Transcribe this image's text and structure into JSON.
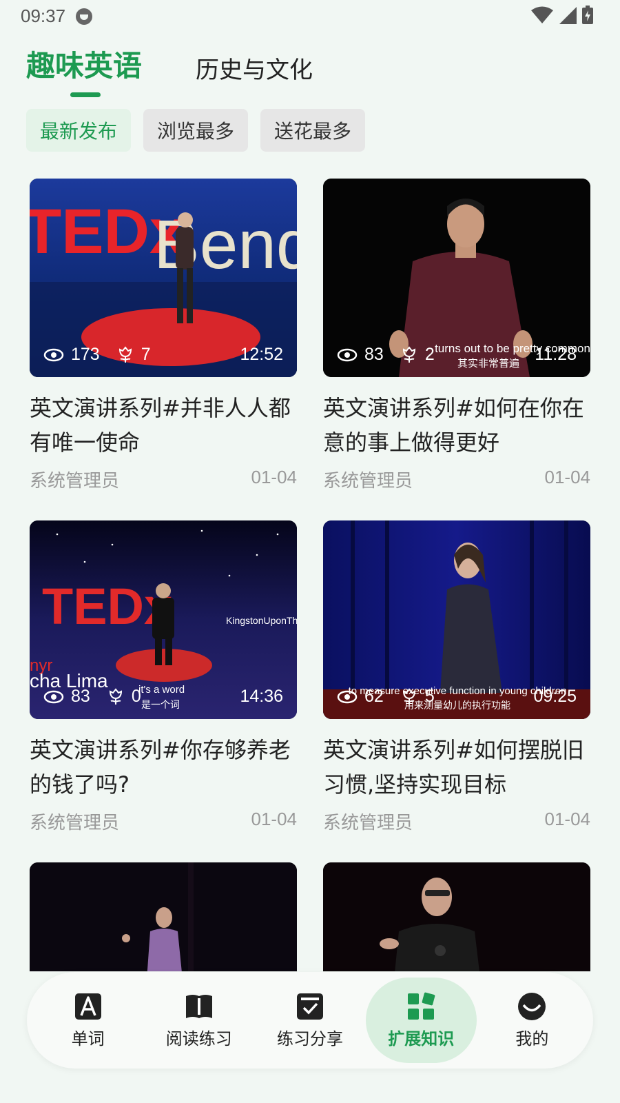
{
  "status_bar": {
    "time": "09:37"
  },
  "top_tabs": [
    {
      "label": "趣味英语",
      "active": true
    },
    {
      "label": "历史与文化",
      "active": false
    }
  ],
  "filters": [
    {
      "label": "最新发布",
      "active": true
    },
    {
      "label": "浏览最多",
      "active": false
    },
    {
      "label": "送花最多",
      "active": false
    }
  ],
  "videos": [
    {
      "title": "英文演讲系列#并非人人都有唯一使命",
      "author": "系统管理员",
      "date": "01-04",
      "views": "173",
      "flowers": "7",
      "duration": "12:52"
    },
    {
      "title": "英文演讲系列#如何在你在意的事上做得更好",
      "author": "系统管理员",
      "date": "01-04",
      "views": "83",
      "flowers": "2",
      "duration": "11:28"
    },
    {
      "title": "英文演讲系列#你存够养老的钱了吗?",
      "author": "系统管理员",
      "date": "01-04",
      "views": "83",
      "flowers": "0",
      "duration": "14:36"
    },
    {
      "title": "英文演讲系列#如何摆脱旧习惯,坚持实现目标",
      "author": "系统管理员",
      "date": "01-04",
      "views": "62",
      "flowers": "5",
      "duration": "09:25"
    }
  ],
  "thumb_text": {
    "v1": {
      "logo": "TEDx",
      "sign": "Bend"
    },
    "v2": {
      "subtitle_en": "turns out to be pretty common",
      "subtitle_zh": "其实非常普遍"
    },
    "v3": {
      "logo": "TEDx",
      "sign": "KingstonUponThames",
      "lower": "cha Lima",
      "lower2": "nyr",
      "subtitle_en": "it's a word",
      "subtitle_zh": "是一个词"
    },
    "v4": {
      "subtitle_en": "to measure executive function in young children",
      "subtitle_zh": "用来测量幼儿的执行功能"
    }
  },
  "bottom_nav": [
    {
      "label": "单词",
      "icon": "letter-a-icon",
      "active": false
    },
    {
      "label": "阅读练习",
      "icon": "open-book-icon",
      "active": false
    },
    {
      "label": "练习分享",
      "icon": "check-box-icon",
      "active": false
    },
    {
      "label": "扩展知识",
      "icon": "grid-blocks-icon",
      "active": true
    },
    {
      "label": "我的",
      "icon": "smile-icon",
      "active": false
    }
  ],
  "colors": {
    "accent": "#1d9a51",
    "background": "#f1f7f3"
  }
}
